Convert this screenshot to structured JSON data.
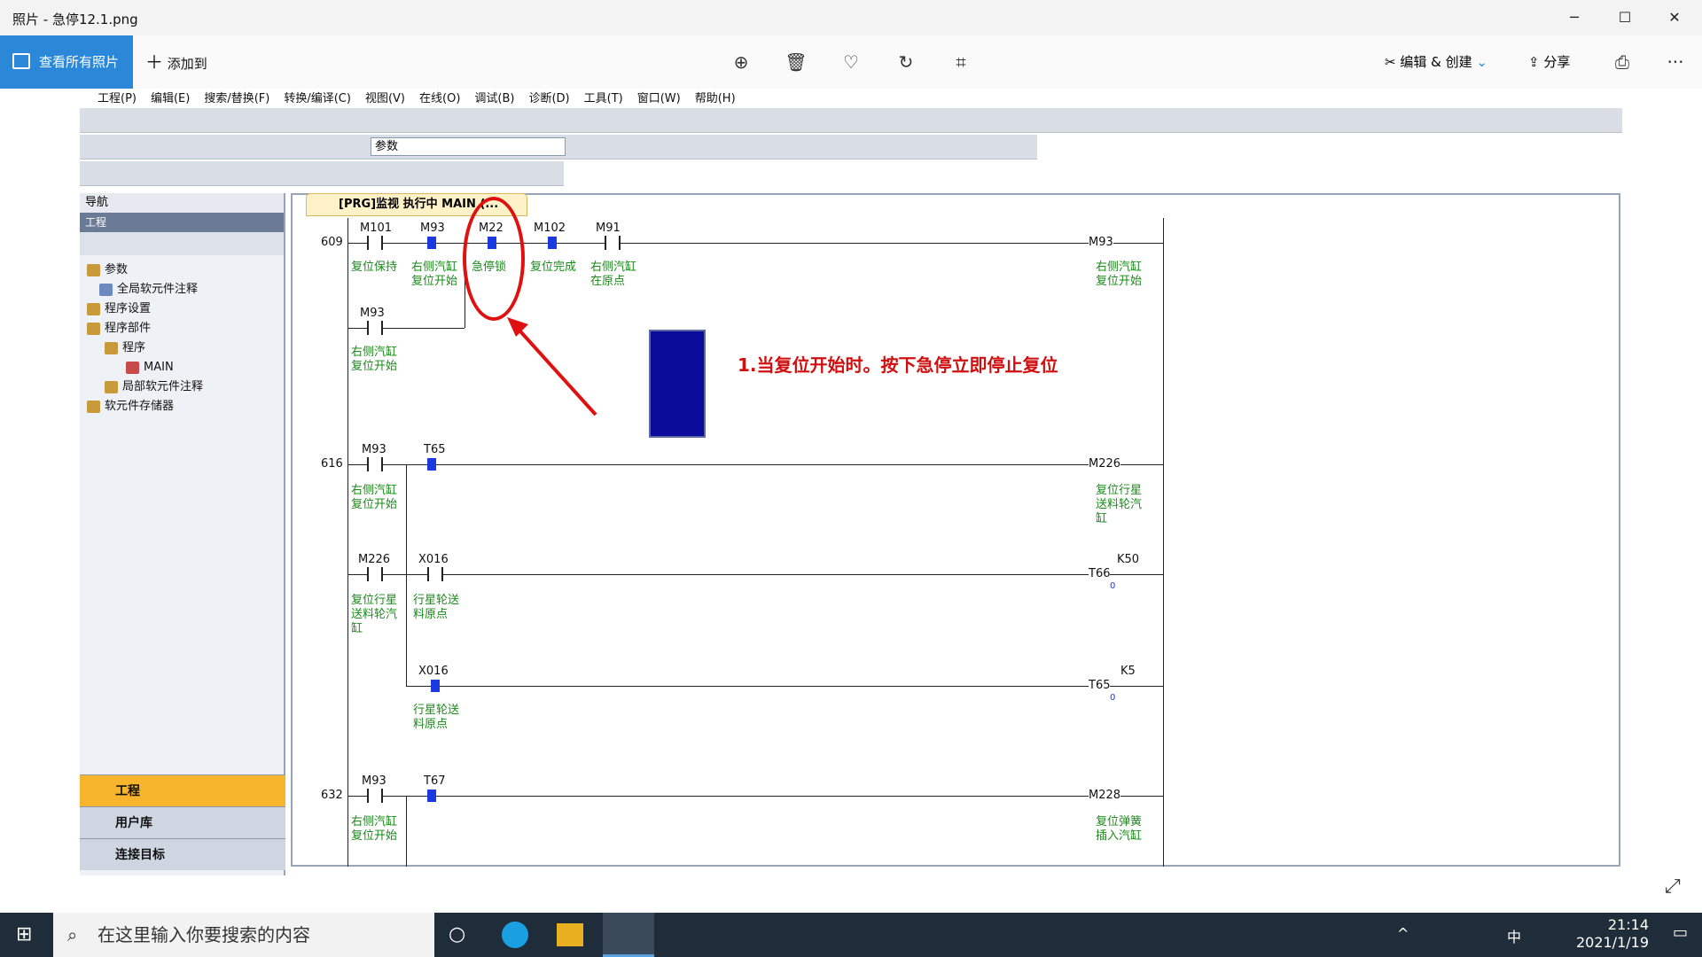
{
  "window": {
    "title": "照片 - 急停12.1.png",
    "min": "─",
    "max": "☐",
    "close": "✕"
  },
  "cmdbar": {
    "view_all": "查看所有照片",
    "add_to": "添加到",
    "edit_create": "编辑 & 创建",
    "share": "分享",
    "more": "···"
  },
  "gx": {
    "menu": [
      "工程(P)",
      "编辑(E)",
      "搜索/替换(F)",
      "转换/编译(C)",
      "视图(V)",
      "在线(O)",
      "调试(B)",
      "诊断(D)",
      "工具(T)",
      "窗口(W)",
      "帮助(H)"
    ],
    "param_dropdown": "参数",
    "nav": {
      "title": "导航",
      "section": "工程",
      "tree": [
        "参数",
        "全局软元件注释",
        "程序设置",
        "程序部件",
        "程序",
        "MAIN",
        "局部软元件注释",
        "软元件存储器"
      ],
      "buttons": [
        "工程",
        "用户库",
        "连接目标"
      ]
    },
    "tab": "[PRG]监视 执行中 MAIN (..."
  },
  "ladder": {
    "rungs": [
      {
        "step": "609",
        "coil": "M93",
        "coil_comment": [
          "右侧汽缸",
          "复位开始"
        ]
      },
      {
        "step": "616",
        "coil": "M226",
        "coil_comment": [
          "复位行星",
          "送料轮汽",
          "缸"
        ]
      },
      {
        "step": "632",
        "coil": "M228",
        "coil_comment": [
          "复位弹簧",
          "插入汽缸"
        ]
      }
    ],
    "contacts": {
      "M101": "M101",
      "M93": "M93",
      "M22": "M22",
      "M102": "M102",
      "M91": "M91",
      "T65": "T65",
      "M226": "M226",
      "X016": "X016",
      "T67": "T67"
    },
    "comments": {
      "c_m101": [
        "复位保持"
      ],
      "c_m93": [
        "右侧汽缸",
        "复位开始"
      ],
      "c_m22": [
        "急停锁"
      ],
      "c_m102": [
        "复位完成"
      ],
      "c_m91": [
        "右侧汽缸",
        "在原点"
      ],
      "c_m226": [
        "复位行星",
        "送料轮汽",
        "缸"
      ],
      "c_x016": [
        "行星轮送",
        "料原点"
      ]
    },
    "timers": [
      {
        "coil": "T66",
        "k": "K50",
        "val": "0"
      },
      {
        "coil": "T65",
        "k": "K5",
        "val": "0"
      }
    ]
  },
  "annotation": "1.当复位开始时。按下急停立即停止复位",
  "taskbar": {
    "search_placeholder": "在这里输入你要搜索的内容",
    "time": "21:14",
    "date": "2021/1/19",
    "ime": "中"
  },
  "colors": {
    "accent": "#2b88d8",
    "monitor_on": "#1a3ae0",
    "comment": "#1a8a1a",
    "annot": "#d01010"
  }
}
